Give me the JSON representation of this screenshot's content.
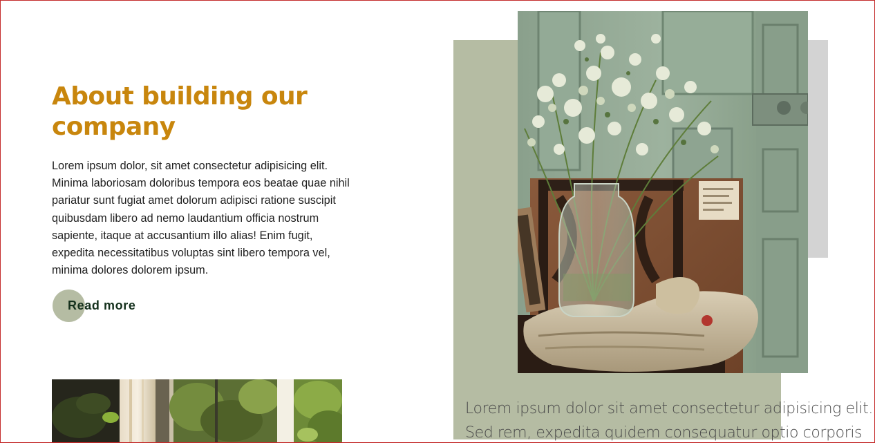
{
  "about": {
    "heading": "About building our company",
    "paragraph": "Lorem ipsum dolor, sit amet consectetur adipisicing elit. Minima laboriosam doloribus tempora eos beatae quae nihil pariatur sunt fugiat amet dolorum adipisci ratione suscipit quibusdam libero ad nemo laudantium officia nostrum sapiente, itaque at accusantium illo alias! Enim fugit, expedita necessitatibus voluptas sint libero tempora vel, minima dolores dolorem ipsum.",
    "read_more_label": "Read more"
  },
  "caption": {
    "line1": "Lorem ipsum dolor sit amet consectetur adipisicing elit.",
    "line2": "Sed rem, expedita quidem consequatur optio corporis"
  },
  "colors": {
    "heading": "#c8860d",
    "sage": "#b5bca3",
    "gray_block": "#d3d3d3",
    "button_text": "#14301c"
  }
}
